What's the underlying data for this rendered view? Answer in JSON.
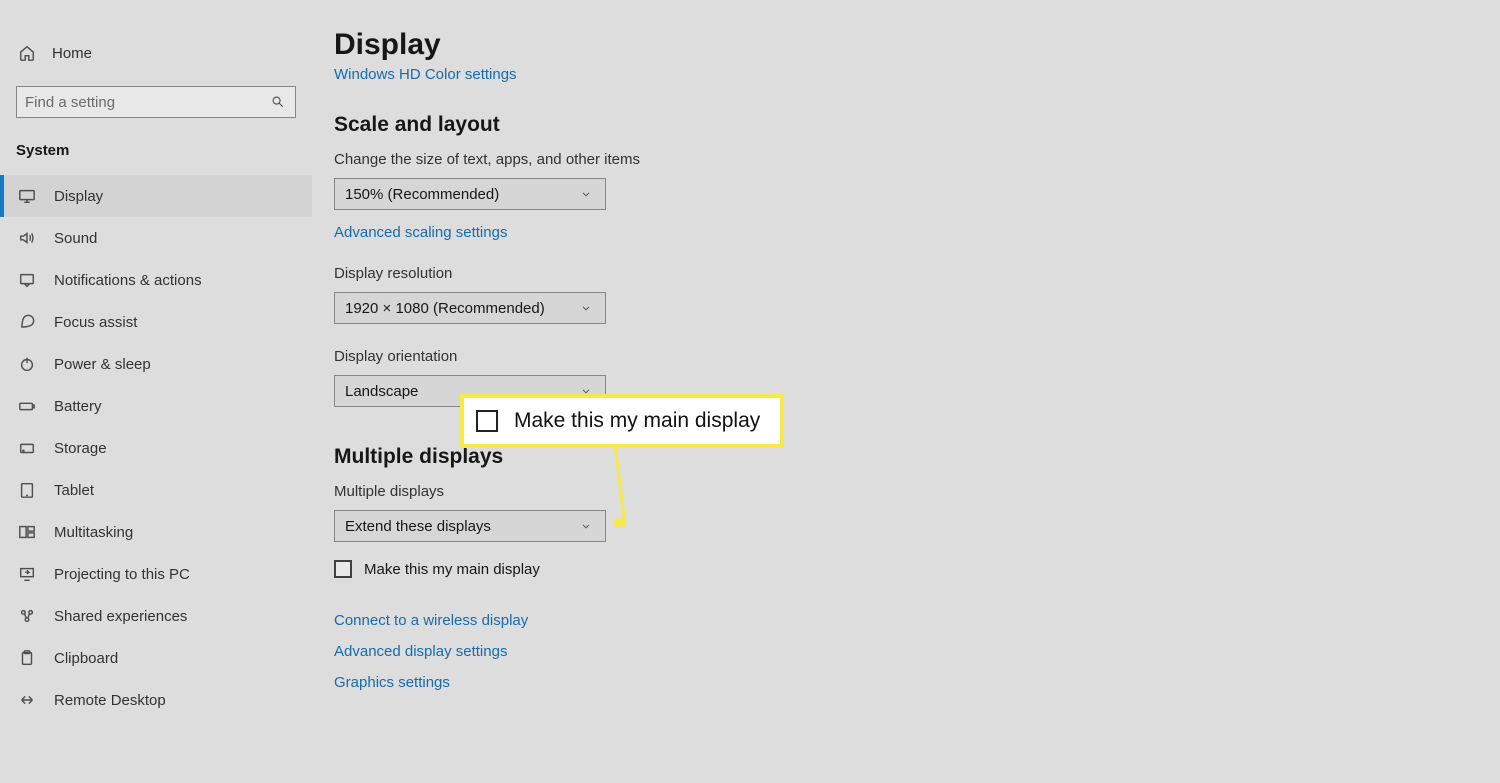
{
  "sidebar": {
    "home": "Home",
    "search_placeholder": "Find a setting",
    "category": "System",
    "items": [
      {
        "label": "Display",
        "icon": "display-icon",
        "active": true
      },
      {
        "label": "Sound",
        "icon": "sound-icon"
      },
      {
        "label": "Notifications & actions",
        "icon": "notifications-icon"
      },
      {
        "label": "Focus assist",
        "icon": "focus-assist-icon"
      },
      {
        "label": "Power & sleep",
        "icon": "power-icon"
      },
      {
        "label": "Battery",
        "icon": "battery-icon"
      },
      {
        "label": "Storage",
        "icon": "storage-icon"
      },
      {
        "label": "Tablet",
        "icon": "tablet-icon"
      },
      {
        "label": "Multitasking",
        "icon": "multitasking-icon"
      },
      {
        "label": "Projecting to this PC",
        "icon": "projecting-icon"
      },
      {
        "label": "Shared experiences",
        "icon": "shared-icon"
      },
      {
        "label": "Clipboard",
        "icon": "clipboard-icon"
      },
      {
        "label": "Remote Desktop",
        "icon": "remote-icon"
      }
    ]
  },
  "main": {
    "title": "Display",
    "hd_color_link": "Windows HD Color settings",
    "scale_section": "Scale and layout",
    "scale_label": "Change the size of text, apps, and other items",
    "scale_value": "150% (Recommended)",
    "adv_scaling_link": "Advanced scaling settings",
    "resolution_label": "Display resolution",
    "resolution_value": "1920 × 1080 (Recommended)",
    "orientation_label": "Display orientation",
    "orientation_value": "Landscape",
    "multi_section": "Multiple displays",
    "multi_label": "Multiple displays",
    "multi_value": "Extend these displays",
    "main_display_check": "Make this my main display",
    "connect_wireless": "Connect to a wireless display",
    "adv_display": "Advanced display settings",
    "graphics": "Graphics settings"
  },
  "callout": {
    "label": "Make this my main display"
  }
}
